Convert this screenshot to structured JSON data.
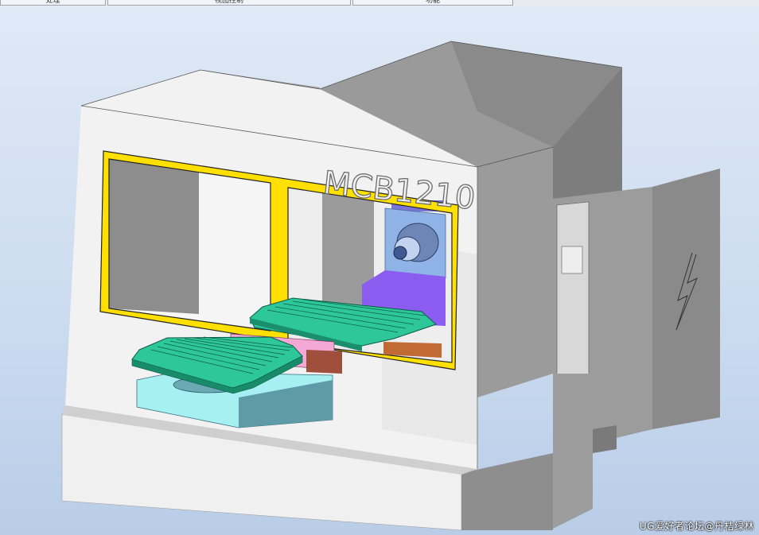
{
  "toolbar": {
    "tabs": [
      {
        "label": "处理"
      },
      {
        "label": "视图控制"
      },
      {
        "label": "功能"
      }
    ]
  },
  "model": {
    "label": "MCB1210",
    "colors": {
      "body": "#f3f3f3",
      "body_shadow": "#7f7f7f",
      "frame": "#ffe000",
      "table_green": "#2ec79a",
      "spindle_blue": "#8fb3e6",
      "violet": "#8a5cf0",
      "cyan": "#a6f0f2",
      "pink": "#f3a8d6"
    }
  },
  "watermark": "UG爱好者论坛@丹桔绿林"
}
